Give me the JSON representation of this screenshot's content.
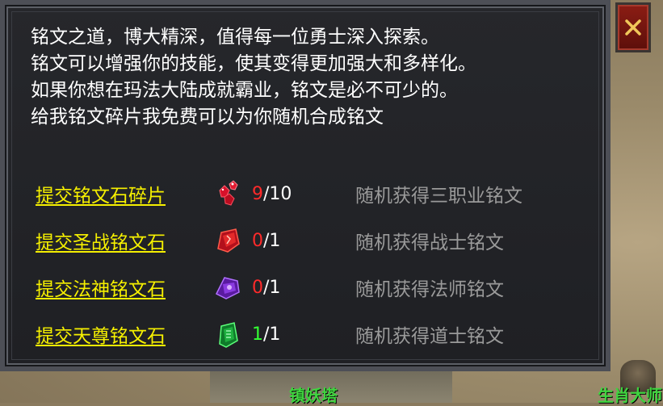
{
  "intro": {
    "lines": [
      "铭文之道，博大精深，值得每一位勇士深入探索。",
      "铭文可以增强你的技能，使其变得更加强大和多样化。",
      "如果你想在玛法大陆成就霸业，铭文是必不可少的。",
      "给我铭文碎片我免费可以为你随机合成铭文"
    ]
  },
  "rows": [
    {
      "label": "提交铭文石碎片",
      "icon": "red-shards-icon",
      "have": "9",
      "separator": "/",
      "need": "10",
      "have_color": "#ff2a2a",
      "reward": "随机获得三职业铭文"
    },
    {
      "label": "提交圣战铭文石",
      "icon": "red-rune-stone-icon",
      "have": "0",
      "separator": "/",
      "need": "1",
      "have_color": "#ff2a2a",
      "reward": "随机获得战士铭文"
    },
    {
      "label": "提交法神铭文石",
      "icon": "purple-rune-stone-icon",
      "have": "0",
      "separator": "/",
      "need": "1",
      "have_color": "#ff2a2a",
      "reward": "随机获得法师铭文"
    },
    {
      "label": "提交天尊铭文石",
      "icon": "green-rune-stone-icon",
      "have": "1",
      "separator": "/",
      "need": "1",
      "have_color": "#33ff33",
      "reward": "随机获得道士铭文"
    }
  ],
  "close_icon": "close-x-icon",
  "world": {
    "npc_label_1": "镇妖塔",
    "npc_label_2": "生肖大师"
  }
}
